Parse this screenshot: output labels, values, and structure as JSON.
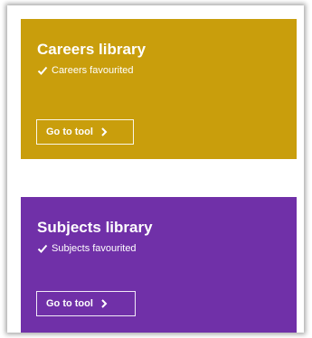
{
  "colors": {
    "careers_bg": "#c99e0c",
    "subjects_bg": "#7030a8",
    "text": "#ffffff"
  },
  "cards": [
    {
      "title": "Careers library",
      "status_icon": "check-icon",
      "status": "Careers favourited",
      "button_label": "Go to tool",
      "button_icon": "chevron-right-icon"
    },
    {
      "title": "Subjects library",
      "status_icon": "check-icon",
      "status": "Subjects favourited",
      "button_label": "Go to tool",
      "button_icon": "chevron-right-icon"
    }
  ]
}
